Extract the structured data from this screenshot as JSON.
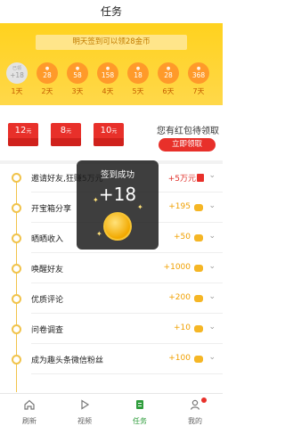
{
  "header": {
    "title": "任务"
  },
  "signin": {
    "banner": "明天签到可以领28金币",
    "days": [
      {
        "top": "已领",
        "amount": "+18",
        "label": "1天",
        "done": true
      },
      {
        "top": "",
        "amount": "28",
        "label": "2天",
        "done": false
      },
      {
        "top": "",
        "amount": "58",
        "label": "3天",
        "done": false
      },
      {
        "top": "",
        "amount": "158",
        "label": "4天",
        "done": false
      },
      {
        "top": "",
        "amount": "18",
        "label": "5天",
        "done": false
      },
      {
        "top": "",
        "amount": "28",
        "label": "6天",
        "done": false
      },
      {
        "top": "",
        "amount": "368",
        "label": "7天",
        "done": false
      }
    ]
  },
  "redpacket": {
    "packets": [
      {
        "amount": "12",
        "unit": "元"
      },
      {
        "amount": "8",
        "unit": "元"
      },
      {
        "amount": "10",
        "unit": "元"
      }
    ],
    "text": "您有红包待领取",
    "button": "立即领取"
  },
  "tasks": [
    {
      "name": "邀请好友,狂赚5万元",
      "reward": "+5万元",
      "kind": "gift"
    },
    {
      "name": "开宝箱分享",
      "reward": "+195",
      "kind": "coin"
    },
    {
      "name": "晒晒收入",
      "reward": "+50",
      "kind": "coin"
    },
    {
      "name": "唤醒好友",
      "reward": "+1000",
      "kind": "coin"
    },
    {
      "name": "优质评论",
      "reward": "+200",
      "kind": "coin"
    },
    {
      "name": "问卷调查",
      "reward": "+10",
      "kind": "coin"
    },
    {
      "name": "成为趣头条微信粉丝",
      "reward": "+100",
      "kind": "coin"
    }
  ],
  "toast": {
    "title": "签到成功",
    "amount": "+18"
  },
  "tabbar": {
    "tabs": [
      {
        "label": "刷新",
        "icon": "home-icon",
        "active": false
      },
      {
        "label": "视频",
        "icon": "play-icon",
        "active": false
      },
      {
        "label": "任务",
        "icon": "task-icon",
        "active": true
      },
      {
        "label": "我的",
        "icon": "user-icon",
        "active": false
      }
    ]
  },
  "colors": {
    "accent": "#ffd21e",
    "red": "#e8302a",
    "reward": "#f0a000",
    "active_tab": "#2f9d3c"
  }
}
